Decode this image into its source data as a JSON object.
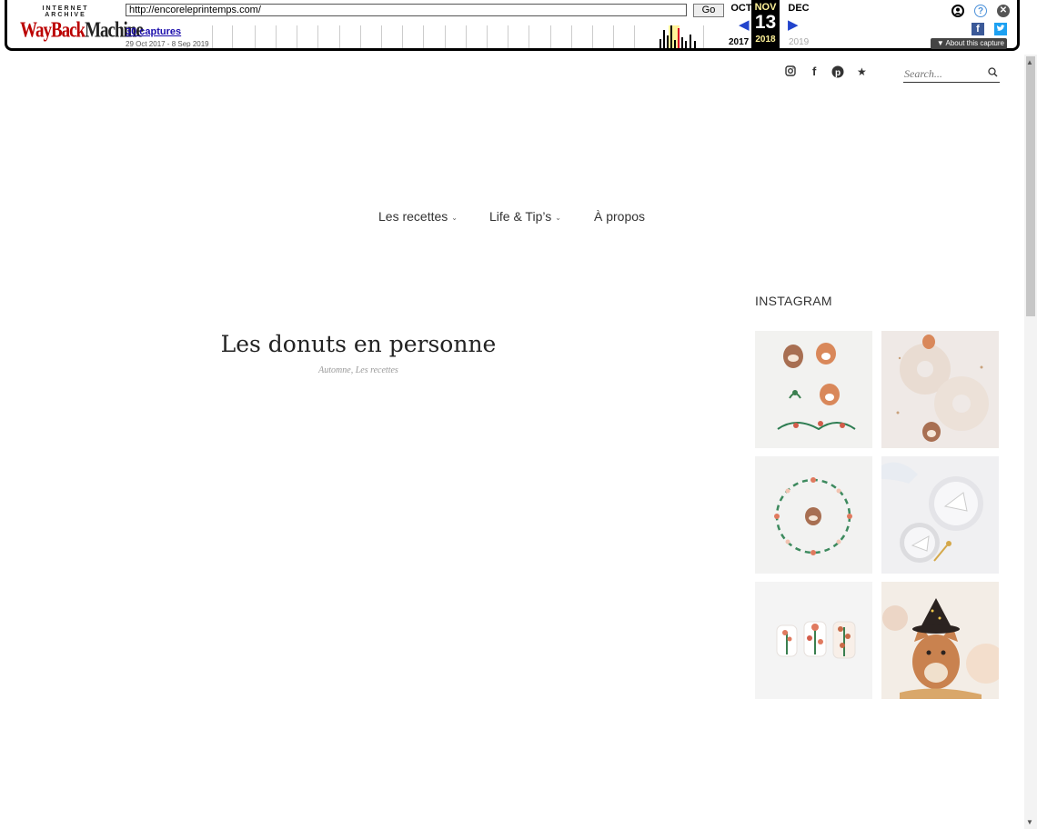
{
  "wayback": {
    "logo_top": "INTERNET ARCHIVE",
    "logo_main_1": "WayBack",
    "logo_main_2": "Machine",
    "url": "http://encoreleprintemps.com/",
    "go_label": "Go",
    "captures_label": "30 captures",
    "date_range": "29 Oct 2017 - 8 Sep 2019",
    "prev_month": "OCT",
    "current_month": "NOV",
    "next_month": "DEC",
    "current_day": "13",
    "prev_year": "2017",
    "current_year": "2018",
    "next_year": "2019",
    "about_label": "▼ About this capture",
    "highlight_color": "#fff399",
    "facebook_glyph": "f"
  },
  "header": {
    "social_icons": [
      "instagram-icon",
      "facebook-icon",
      "pinterest-icon",
      "star-icon"
    ],
    "search_placeholder": "Search..."
  },
  "nav": {
    "items": [
      {
        "label": "Les recettes",
        "has_dropdown": true
      },
      {
        "label": "Life & Tip’s",
        "has_dropdown": true
      },
      {
        "label": "À propos",
        "has_dropdown": false
      }
    ]
  },
  "post": {
    "title": "Les donuts en personne",
    "categories": "Automne, Les recettes"
  },
  "sidebar": {
    "instagram_title": "INSTAGRAM",
    "photos": [
      "raccoon-fox-cookies-photo",
      "donuts-raccoon-photo",
      "floral-wreath-cookie-photo",
      "cake-slice-plates-photo",
      "floral-cookies-photo",
      "cat-witch-hat-photo"
    ]
  }
}
